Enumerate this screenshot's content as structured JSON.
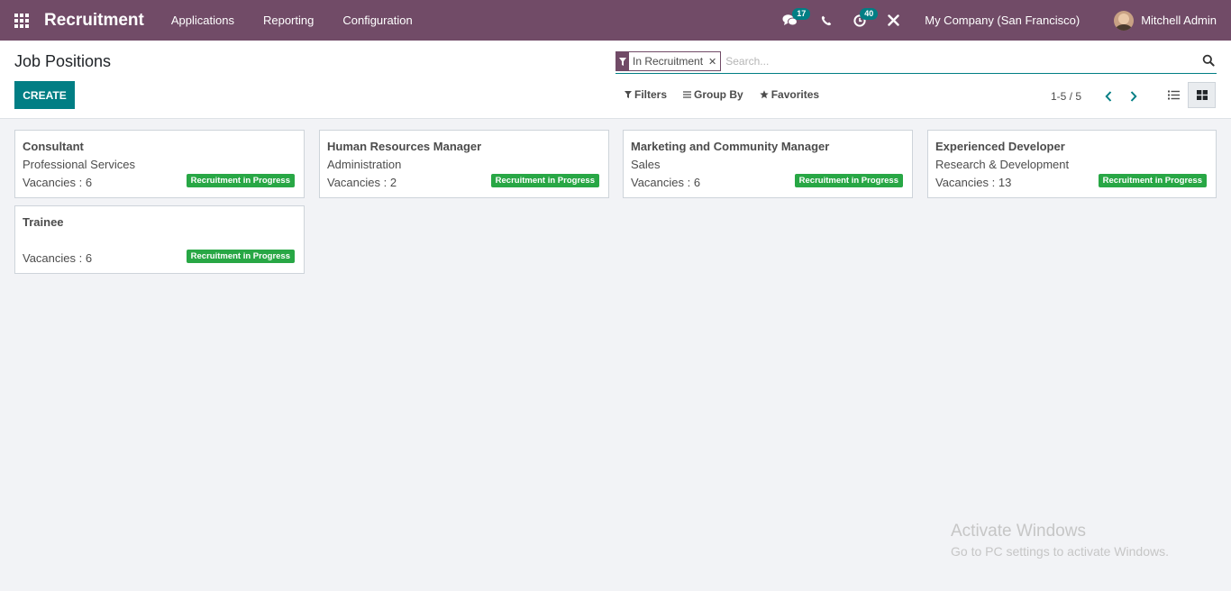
{
  "navbar": {
    "app_name": "Recruitment",
    "menu": [
      "Applications",
      "Reporting",
      "Configuration"
    ],
    "messages_count": "17",
    "activities_count": "40",
    "company": "My Company (San Francisco)",
    "user": "Mitchell Admin",
    "color": "#714b67"
  },
  "control_panel": {
    "title": "Job Positions",
    "create_label": "CREATE",
    "facet": "In Recruitment",
    "search_placeholder": "Search...",
    "filters_label": "Filters",
    "group_by_label": "Group By",
    "favorites_label": "Favorites",
    "pager": "1-5 / 5",
    "accent": "#017e84"
  },
  "jobs": [
    {
      "title": "Consultant",
      "department": "Professional Services",
      "vacancies": "Vacancies : 6",
      "status": "Recruitment in Progress"
    },
    {
      "title": "Human Resources Manager",
      "department": "Administration",
      "vacancies": "Vacancies : 2",
      "status": "Recruitment in Progress"
    },
    {
      "title": "Marketing and Community Manager",
      "department": "Sales",
      "vacancies": "Vacancies : 6",
      "status": "Recruitment in Progress"
    },
    {
      "title": "Experienced Developer",
      "department": "Research & Development",
      "vacancies": "Vacancies : 13",
      "status": "Recruitment in Progress"
    },
    {
      "title": "Trainee",
      "department": "",
      "vacancies": "Vacancies : 6",
      "status": "Recruitment in Progress"
    }
  ],
  "watermark": {
    "title": "Activate Windows",
    "subtitle": "Go to PC settings to activate Windows."
  }
}
